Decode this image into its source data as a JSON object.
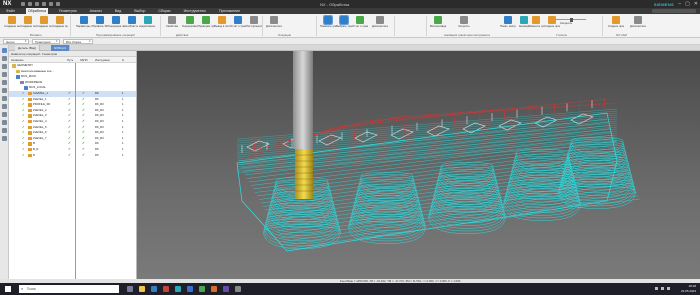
{
  "titlebar": {
    "app_logo": "NX",
    "window_title": "NX - Обработка",
    "brand": "SIEMENS",
    "min": "–",
    "max": "▢",
    "close": "✕"
  },
  "menubar": {
    "items": [
      "Файл",
      "Обработка",
      "Геометрия",
      "Анализ",
      "Вид",
      "Выбор",
      "Сборки",
      "Инструменты",
      "Приложение"
    ],
    "active_index": 1
  },
  "ribbon": {
    "buttons": [
      "Создание инструмента",
      "Создание геометрии",
      "Создание операции",
      "Создание программы",
      "Паpаметры фрезерования",
      "Профиль 3D",
      "Генерация программ",
      "На область обработки",
      "Адаптивное фрезерование",
      "Свойства",
      "Генерировать траекторию",
      "Проверка траектории",
      "Вывод в постпроцессор",
      "Отчет о траектории",
      "Постпроцессирование",
      "Дополнительно",
      "Показать траекторию",
      "Выбрать траекторию",
      "Отчет о траектории инструмента",
      "Дополнительно",
      "Воспроизведение",
      "Скорость",
      "Показ. инстр.",
      "Анимир.",
      "Изменить траекторию",
      "Создать программу",
      "Создать процесс",
      "Дополнительно"
    ],
    "groups": [
      "Вставить",
      "Программирование операций",
      "Действия",
      "Операции",
      "Анимация траектории инструмента",
      "Утилиты",
      "NX CAM"
    ],
    "speed_label": "Скорость"
  },
  "filterbar": {
    "filter1": "Целое",
    "filter2": "Траектория",
    "filter3": "Вся сборка"
  },
  "tabs": [
    {
      "label": "Деталь (Вид)"
    },
    {
      "label": "NX84.prt"
    }
  ],
  "navigator": {
    "title": "Навигатор операций - Геометрия",
    "columns": {
      "name": "Название",
      "path": "Путь",
      "status": "ЗАПО",
      "tool": "Инструмент",
      "num": "Н"
    },
    "rows": [
      {
        "name": "GEOMETRY",
        "indent": 0,
        "check1": "",
        "check2": "",
        "tool": "",
        "num": "",
        "icon": "folder"
      },
      {
        "name": "Неиспользованные эле...",
        "indent": 1,
        "check1": "",
        "check2": "",
        "tool": "",
        "num": "",
        "icon": "folder"
      },
      {
        "name": "MCS_MAIN",
        "indent": 1,
        "check1": "",
        "check2": "",
        "tool": "",
        "num": "",
        "icon": "mcs"
      },
      {
        "name": "WORKPIECE",
        "indent": 2,
        "check1": "",
        "check2": "",
        "tool": "",
        "num": "",
        "icon": "wp"
      },
      {
        "name": "MCS_LOCAL",
        "indent": 3,
        "check1": "",
        "check2": "",
        "tool": "",
        "num": "",
        "icon": "mcs"
      },
      {
        "name": "CAVMILL_1",
        "indent": 4,
        "check1": "✓",
        "check2": "✓",
        "tool": "D6",
        "num": "1",
        "icon": "op",
        "selected": true
      },
      {
        "name": "ZLEVEL_1",
        "indent": 4,
        "check1": "✓",
        "check2": "✓",
        "tool": "D6",
        "num": "1",
        "icon": "op"
      },
      {
        "name": "PROFILE_3D",
        "indent": 4,
        "check1": "✓",
        "check2": "✓",
        "tool": "D6_R3",
        "num": "1",
        "icon": "op"
      },
      {
        "name": "ZLEVEL_2",
        "indent": 4,
        "check1": "✓",
        "check2": "✓",
        "tool": "D6_R3",
        "num": "1",
        "icon": "op"
      },
      {
        "name": "ZLEVEL_3",
        "indent": 4,
        "check1": "✓",
        "check2": "✓",
        "tool": "D6_R3",
        "num": "1",
        "icon": "op"
      },
      {
        "name": "ZLEVEL_4",
        "indent": 4,
        "check1": "✓",
        "check2": "✓",
        "tool": "D6_R3",
        "num": "1",
        "icon": "op"
      },
      {
        "name": "ZLEVEL_5",
        "indent": 4,
        "check1": "✓",
        "check2": "✓",
        "tool": "D6_R3",
        "num": "1",
        "icon": "op"
      },
      {
        "name": "ZLEVEL_6",
        "indent": 4,
        "check1": "✓",
        "check2": "✓",
        "tool": "D6_R3",
        "num": "1",
        "icon": "op"
      },
      {
        "name": "ZLEVEL_7",
        "indent": 4,
        "check1": "✓",
        "check2": "✓",
        "tool": "D6_R3",
        "num": "1",
        "icon": "op"
      },
      {
        "name": "B",
        "indent": 4,
        "check1": "✓",
        "check2": "✓",
        "tool": "D6",
        "num": "1",
        "icon": "op"
      },
      {
        "name": "B_R",
        "indent": 4,
        "check1": "✓",
        "check2": "✓",
        "tool": "D5",
        "num": "1",
        "icon": "op"
      },
      {
        "name": "D",
        "indent": 4,
        "check1": "✓",
        "check2": "✓",
        "tool": "D5",
        "num": "1",
        "icon": "op"
      }
    ]
  },
  "statusbar": {
    "coords": "Feed Rate = 1250.000, X8 = -31.622, YM = -17.272, ZM = 11.591, I = 0.000, J = 0.000, K = 1.000"
  },
  "taskbar": {
    "search_placeholder": "Поиск",
    "time": "18:18",
    "date": "23.05.2023",
    "lang": "РУС"
  },
  "colors": {
    "accent": "#5b88c7",
    "toolpath_cyan": "#29e3e6",
    "toolpath_red": "#e03232",
    "tool_yellow": "#e8c21c"
  }
}
